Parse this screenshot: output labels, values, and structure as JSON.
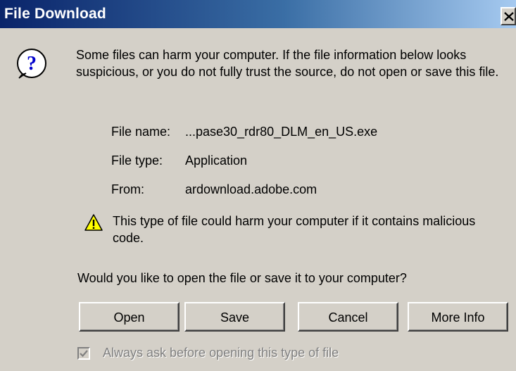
{
  "window": {
    "title": "File Download",
    "close_label": "close"
  },
  "message": {
    "warning": "Some files can harm your computer. If the file information below looks suspicious, or you do not fully trust the source, do not open or save this file."
  },
  "file_info": {
    "name_label": "File name:",
    "name_value": "...pase30_rdr80_DLM_en_US.exe",
    "type_label": "File type:",
    "type_value": "Application",
    "from_label": "From:",
    "from_value": "ardownload.adobe.com"
  },
  "caution": {
    "text": "This type of file could harm your computer if it contains malicious code."
  },
  "prompt": {
    "text": "Would you like to open the file or save it to your computer?"
  },
  "buttons": {
    "open": "Open",
    "save": "Save",
    "cancel": "Cancel",
    "more_info": "More Info"
  },
  "checkbox": {
    "label": "Always ask before opening this type of file",
    "checked": true,
    "enabled": false
  },
  "colors": {
    "dialog_bg": "#d4d0c8",
    "titlebar_start": "#0a246a",
    "titlebar_end": "#a6caf0",
    "disabled_text": "#808080"
  },
  "icons": {
    "dialog": "question-icon",
    "caution": "warning-icon",
    "close": "close-icon",
    "check": "checkmark-icon"
  }
}
